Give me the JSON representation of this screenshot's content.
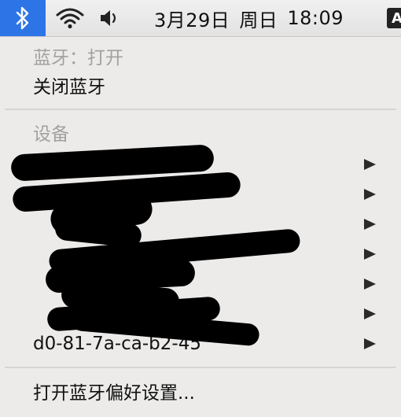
{
  "menubar": {
    "clock": {
      "date": "3月29日",
      "weekday": "周日",
      "time": "18:09"
    },
    "input_source_label": "A",
    "icons": [
      "bluetooth-icon",
      "wifi-icon",
      "volume-icon"
    ],
    "bluetooth_active_color": "#2d74e6"
  },
  "bluetooth_menu": {
    "status": "蓝牙：打开",
    "turn_off": "关闭蓝牙",
    "devices_header": "设备",
    "devices": [
      {
        "label": ""
      },
      {
        "label": ""
      },
      {
        "label": ""
      },
      {
        "label": ""
      },
      {
        "label": ""
      },
      {
        "label": ""
      },
      {
        "label": "d0-81-7a-ca-b2-45"
      }
    ],
    "open_preferences": "打开蓝牙偏好设置..."
  }
}
